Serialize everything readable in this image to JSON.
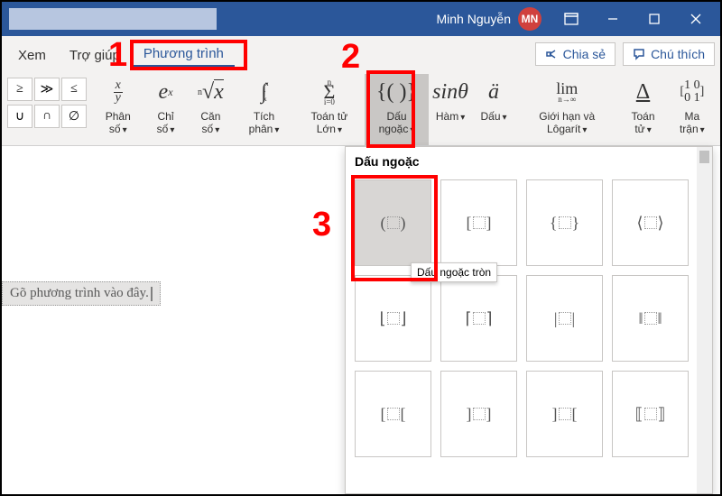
{
  "titlebar": {
    "user_name": "Minh Nguyễn",
    "user_initials": "MN"
  },
  "tabs": {
    "view": "Xem",
    "help": "Trợ giúp",
    "equation": "Phương trình"
  },
  "actions": {
    "share": "Chia sẻ",
    "comment": "Chú thích"
  },
  "ribbon": {
    "fraction": "Phân số",
    "script": "Chỉ số",
    "radical": "Căn số",
    "integral": "Tích phân",
    "large_op": "Toán tử Lớn",
    "bracket": "Dấu ngoặc",
    "function": "Hàm",
    "accent": "Dấu",
    "limit": "Giới hạn và Lôgarít",
    "operator": "Toán tử",
    "matrix": "Ma trận"
  },
  "operators": {
    "r1": [
      "≥",
      "≫",
      "≤"
    ],
    "r2": [
      "∪",
      "∩",
      "∅"
    ]
  },
  "dropdown": {
    "title": "Dấu ngoặc",
    "tooltip": "Dấu ngoặc tròn"
  },
  "document": {
    "equation_placeholder": "Gõ phương trình vào đây."
  },
  "callouts": {
    "n1": "1",
    "n2": "2",
    "n3": "3"
  }
}
